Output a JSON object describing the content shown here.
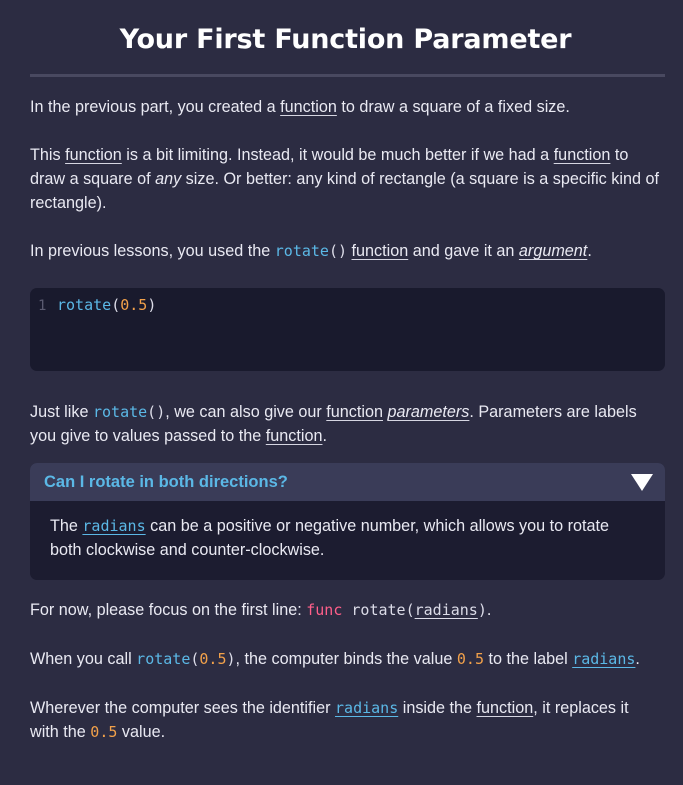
{
  "title": "Your First Function Parameter",
  "p1": {
    "before": "In the previous part, you created a ",
    "link": "function",
    "after": " to draw a square of a fixed size."
  },
  "p2": {
    "a": "This ",
    "link1": "function",
    "b": " is a bit limiting. Instead, it would be much better if we had a ",
    "link2": "function",
    "c": " to draw a square of ",
    "em": "any",
    "d": " size. Or better: any kind of rectangle (a square is a specific kind of rectangle)."
  },
  "p3": {
    "a": "In previous lessons, you used the ",
    "code_fn": "rotate",
    "code_parens": "()",
    "b": " ",
    "link": "function",
    "c": " and gave it an ",
    "em_link": "argument",
    "d": "."
  },
  "codeblock": {
    "line_number": "1",
    "fn": "rotate",
    "open": "(",
    "num": "0.5",
    "close": ")"
  },
  "p4": {
    "a": "Just like ",
    "code_fn": "rotate",
    "code_parens": "()",
    "b": ", we can also give our ",
    "link": "function",
    "c": " ",
    "em_link": "parameters",
    "d": ". Parameters are labels you give to values passed to the ",
    "link2": "function",
    "e": "."
  },
  "callout": {
    "title": "Can I rotate in both directions?",
    "body_a": "The ",
    "body_code": "radians",
    "body_b": " can be a positive or negative number, which allows you to rotate both clockwise and counter-clockwise."
  },
  "p5": {
    "a": "For now, please focus on the first line: ",
    "kw": "func",
    "fn": " rotate(",
    "param": "radians",
    "close": ")",
    "b": "."
  },
  "p6": {
    "a": "When you call ",
    "code_fn": "rotate",
    "code_open": "(",
    "code_num": "0.5",
    "code_close": ")",
    "b": ", the computer binds the value ",
    "num": "0.5",
    "c": " to the label ",
    "param": "radians",
    "d": "."
  },
  "p7": {
    "a": "Wherever the computer sees the identifier ",
    "param": "radians",
    "b": " inside the ",
    "link": "function",
    "c": ", it replaces it with the ",
    "num": "0.5",
    "d": " value."
  }
}
